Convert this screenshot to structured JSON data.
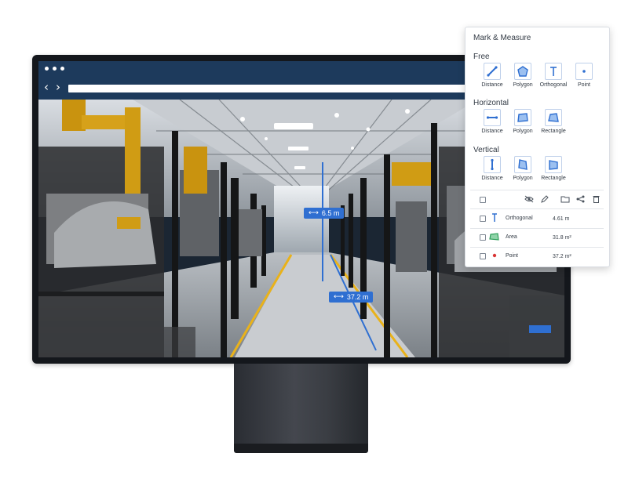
{
  "panel": {
    "title": "Mark & Measure",
    "sections": [
      {
        "title": "Free",
        "tools": [
          {
            "label": "Distance",
            "icon": "diagonal-line-icon"
          },
          {
            "label": "Polygon",
            "icon": "polygon-icon"
          },
          {
            "label": "Orthogonal",
            "icon": "orthogonal-icon"
          },
          {
            "label": "Point",
            "icon": "point-icon"
          }
        ]
      },
      {
        "title": "Horizontal",
        "tools": [
          {
            "label": "Distance",
            "icon": "horizontal-line-icon"
          },
          {
            "label": "Polygon",
            "icon": "polygon-icon"
          },
          {
            "label": "Rectangle",
            "icon": "rectangle-icon"
          }
        ]
      },
      {
        "title": "Vertical",
        "tools": [
          {
            "label": "Distance",
            "icon": "vertical-line-icon"
          },
          {
            "label": "Polygon",
            "icon": "polygon-icon"
          },
          {
            "label": "Rectangle",
            "icon": "rectangle-icon"
          }
        ]
      }
    ],
    "toolbar_icons": [
      "visibility-off-icon",
      "pencil-icon",
      "folder-icon",
      "share-icon",
      "trash-icon"
    ],
    "measurements": [
      {
        "label": "Orthogonal",
        "value": "4.61 m",
        "icon": "orthogonal-icon",
        "icon_color": "#2f6fd1"
      },
      {
        "label": "Area",
        "value": "31.8 m²",
        "icon": "area-icon",
        "icon_color": "#2e9f5a"
      },
      {
        "label": "Point",
        "value": "37.2 m²",
        "icon": "point-icon",
        "icon_color": "#d93636"
      }
    ]
  },
  "scene": {
    "labels": [
      {
        "text": "6.5 m",
        "icon": "distance-icon"
      },
      {
        "text": "37.2 m",
        "icon": "distance-icon"
      }
    ],
    "accent_color": "#2f6fd1",
    "floor_line_color": "#e9b21a"
  }
}
